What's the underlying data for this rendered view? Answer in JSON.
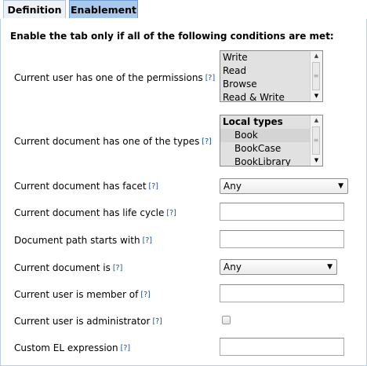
{
  "tabs": [
    {
      "label": "Definition",
      "active": false
    },
    {
      "label": "Enablement",
      "active": true
    }
  ],
  "intro": "Enable the tab only if all of the following conditions are met:",
  "help_marker": "[?]",
  "fields": {
    "permissions": {
      "label": "Current user has one of the permissions",
      "options": [
        "Write",
        "Read",
        "Browse",
        "Read & Write"
      ]
    },
    "types": {
      "label": "Current document has one of the types",
      "group": "Local types",
      "options": [
        "Book",
        "BookCase",
        "BookLibrary"
      ]
    },
    "facet": {
      "label": "Current document has facet",
      "value": "Any"
    },
    "lifecycle": {
      "label": "Current document has life cycle",
      "value": ""
    },
    "path": {
      "label": "Document path starts with",
      "value": ""
    },
    "doc_is": {
      "label": "Current document is",
      "value": "Any"
    },
    "member_of": {
      "label": "Current user is member of",
      "value": ""
    },
    "administrator": {
      "label": "Current user is administrator",
      "checked": false
    },
    "el": {
      "label": "Custom EL expression",
      "value": ""
    }
  },
  "colors": {
    "active_tab": "#a9c9ec",
    "help_link": "#1a4f9c",
    "border": "#b9cfe3"
  }
}
